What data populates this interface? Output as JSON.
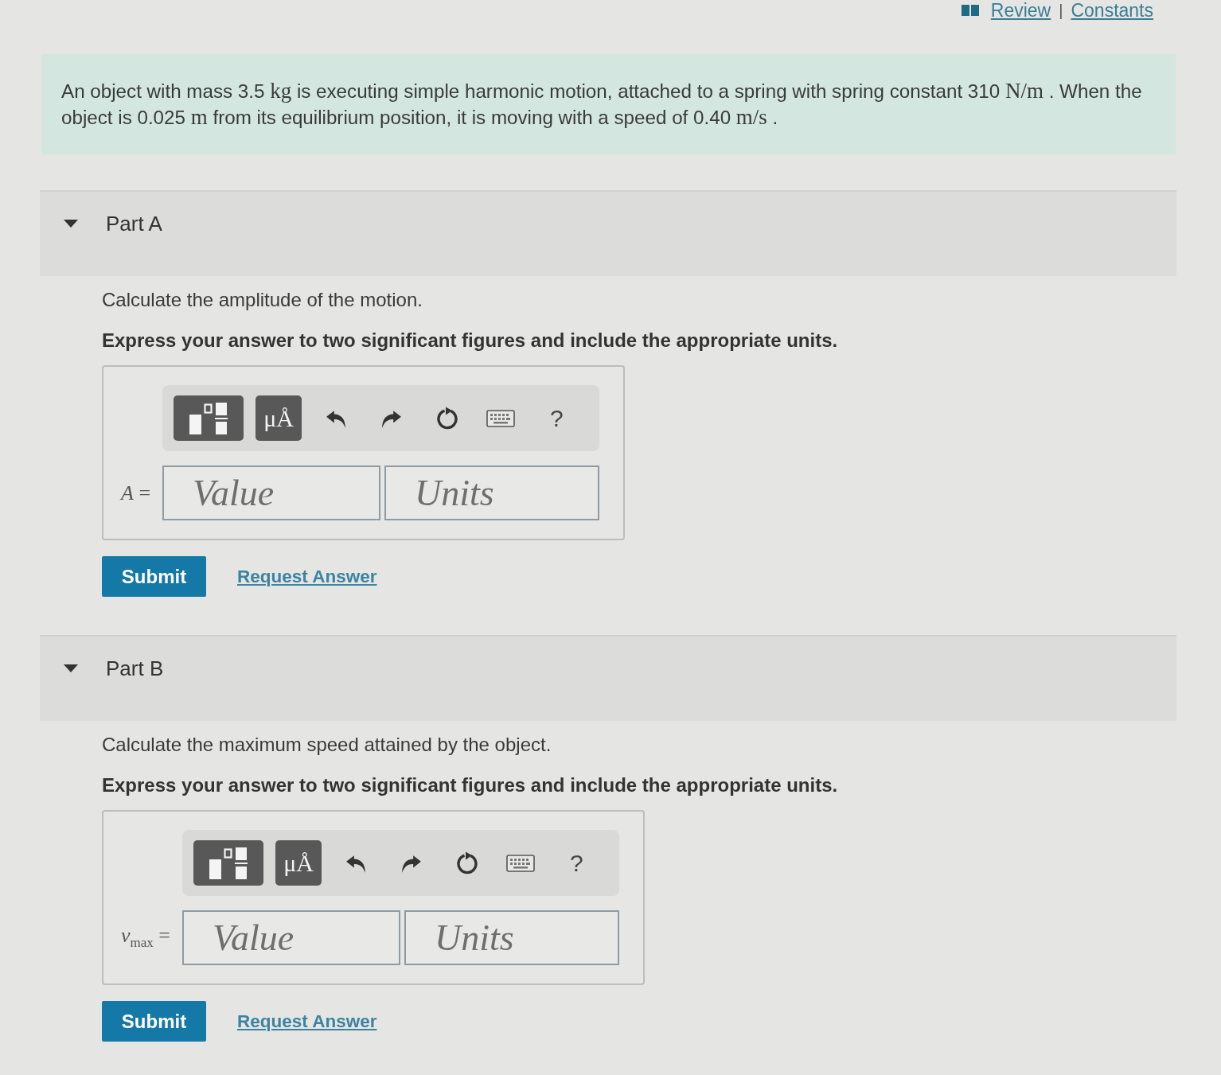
{
  "header_links": {
    "review": "Review",
    "separator": "|",
    "constants": "Constants"
  },
  "problem": {
    "segments": [
      {
        "kind": "text",
        "text": "An object with mass 3.5 "
      },
      {
        "kind": "math",
        "text": "kg"
      },
      {
        "kind": "text",
        "text": " is executing simple harmonic motion, attached to a spring with spring constant 310 "
      },
      {
        "kind": "math",
        "text": "N/m"
      },
      {
        "kind": "text",
        "text": " . When the object is 0.025 "
      },
      {
        "kind": "math",
        "text": "m"
      },
      {
        "kind": "text",
        "text": " from its equilibrium position, it is moving with a speed of 0.40 "
      },
      {
        "kind": "math",
        "text": "m/s"
      },
      {
        "kind": "text",
        "text": " ."
      }
    ]
  },
  "parts": [
    {
      "title": "Part A",
      "expanded": true,
      "question": "Calculate the amplitude of the motion.",
      "instructions": "Express your answer to two significant figures and include the appropriate units.",
      "answer": {
        "label": "*A* =",
        "toolbar": [
          {
            "kind": "templates"
          },
          {
            "kind": "units",
            "label": "μÅ"
          },
          {
            "kind": "undo"
          },
          {
            "kind": "redo"
          },
          {
            "kind": "reset"
          },
          {
            "kind": "keyboard"
          },
          {
            "kind": "help",
            "label": "?"
          }
        ],
        "value": {
          "placeholder": "Value"
        },
        "units": {
          "placeholder": "Units"
        }
      },
      "submit": "Submit",
      "request_answer": "Request Answer"
    },
    {
      "title": "Part B",
      "expanded": true,
      "question": "Calculate the maximum speed attained by the object.",
      "instructions": "Express your answer to two significant figures and include the appropriate units.",
      "answer": {
        "label": "*v*$_{max}$ =",
        "toolbar": [
          {
            "kind": "templates"
          },
          {
            "kind": "units",
            "label": "μÅ"
          },
          {
            "kind": "undo"
          },
          {
            "kind": "redo"
          },
          {
            "kind": "reset"
          },
          {
            "kind": "keyboard"
          },
          {
            "kind": "help",
            "label": "?"
          }
        ],
        "value": {
          "placeholder": "Value"
        },
        "units": {
          "placeholder": "Units"
        }
      },
      "submit": "Submit",
      "request_answer": "Request Answer"
    }
  ]
}
